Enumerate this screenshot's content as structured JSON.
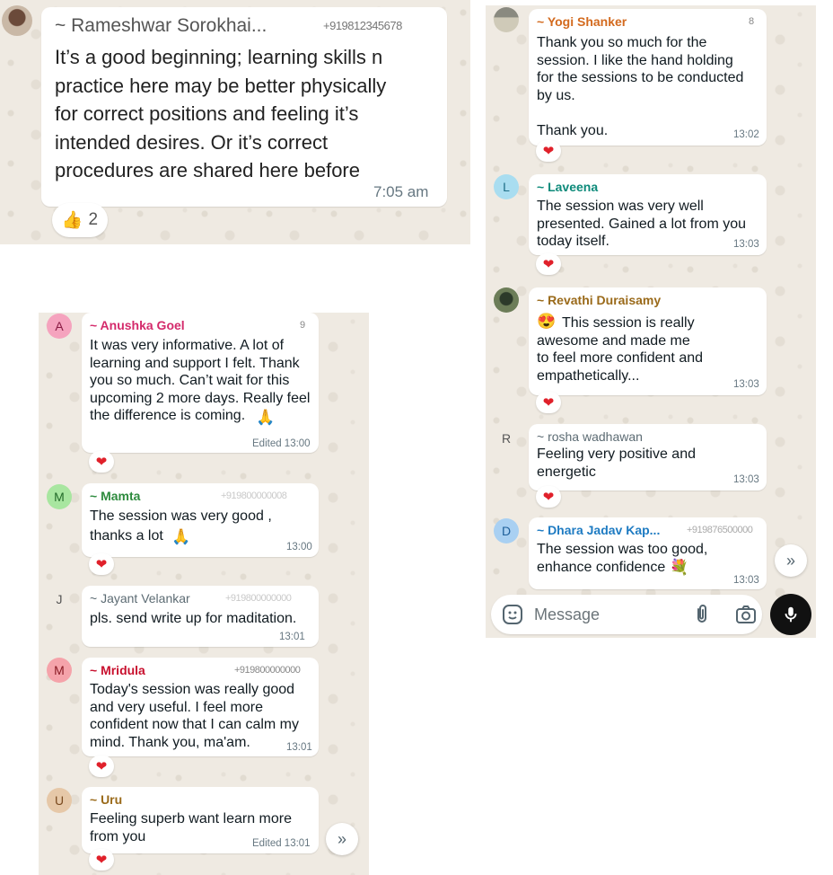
{
  "panel1": {
    "sender": "~ Rameshwar Sorokhai...",
    "phone": "+919812345678",
    "text": "It’s a good beginning; learning skills n\npractice here may be better physically\nfor correct positions and feeling it’s\nintended desires. Or it’s correct\nprocedures are shared here before",
    "time": "7:05 am",
    "reaction_emoji": "👍",
    "reaction_count": "2"
  },
  "panel2": {
    "messages": [
      {
        "sender": "~ Yogi Shanker",
        "phone": "8",
        "text": "Thank you so much for the\nsession.  I like the hand holding\nfor the sessions to be conducted\nby us.\n\nThank you.",
        "time": "13:02"
      },
      {
        "avatar": "L",
        "sender": "~ Laveena",
        "text": "The session was very well\npresented. Gained a lot from you\ntoday itself.",
        "time": "13:03"
      },
      {
        "sender": "~ Revathi Duraisamy",
        "emoji": "😍",
        "text": "This session is really\nawesome and made me\nto feel more confident and\nempathetically...",
        "time": "13:03"
      },
      {
        "avatar": "R",
        "sender": "~ rosha wadhawan",
        "text": "Feeling very positive and\nenergetic",
        "time": "13:03"
      },
      {
        "avatar": "D",
        "sender": "~ Dhara Jadav Kap...",
        "phone": "+919876500000",
        "text": "The session was too good,\nenhance confidence",
        "emoji": "💐",
        "time": "13:03"
      }
    ],
    "composer_placeholder": "Message"
  },
  "panel3": {
    "messages": [
      {
        "avatar": "A",
        "sender": "~ Anushka Goel",
        "phone": "9",
        "text": "It was very informative. A lot of\nlearning and support I felt. Thank\nyou so much. Can’t wait for this\nupcoming 2 more days. Really feel\nthe difference is coming.",
        "emoji": "🙏",
        "time": "Edited 13:00"
      },
      {
        "avatar": "M",
        "sender": "~ Mamta",
        "phone": "+919800000008",
        "text": "The session was very good ,\nthanks a lot",
        "emoji": "🙏",
        "time": "13:00"
      },
      {
        "avatar": "J",
        "sender": "~ Jayant Velankar",
        "phone": "+919800000000",
        "text": "pls. send write up for maditation.",
        "time": "13:01"
      },
      {
        "avatar": "M",
        "sender": "~ Mridula",
        "phone": "+919800000000",
        "text": "Today's session was really good\nand very useful. I feel more\nconfident now that I can calm my\nmind. Thank you, ma'am.",
        "time": "13:01"
      },
      {
        "avatar": "U",
        "sender": "~ Uru",
        "text": "Feeling superb want learn more\nfrom you",
        "time": "Edited 13:01"
      }
    ]
  },
  "reaction_heart": "❤",
  "colors": {
    "chat_bg": "#efeae2",
    "bubble": "#ffffff",
    "heart": "#e0202a",
    "sender_yogi": "#d36a1e",
    "sender_laveena": "#0d8a7a",
    "sender_revathi": "#9a6a1a",
    "sender_rosha": "#5c6b73",
    "sender_dhara": "#1e7bc2",
    "sender_anushka": "#d42a6b",
    "sender_mamta": "#2e8b3e",
    "sender_jayant": "#5c6b73",
    "sender_mridula": "#c8102e",
    "sender_uru": "#9a6a1a"
  },
  "icons": [
    "thumbs-up-icon",
    "heart-icon",
    "sticker-icon",
    "attach-icon",
    "camera-icon",
    "mic-icon",
    "double-chevron-down-icon"
  ]
}
